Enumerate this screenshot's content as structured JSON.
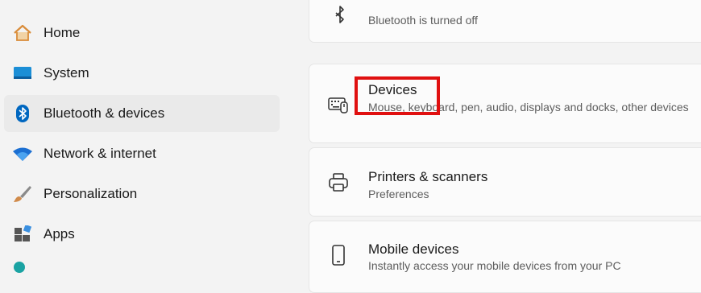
{
  "sidebar": {
    "items": [
      {
        "label": "Home",
        "icon": "home-icon",
        "selected": false
      },
      {
        "label": "System",
        "icon": "system-icon",
        "selected": false
      },
      {
        "label": "Bluetooth & devices",
        "icon": "bluetooth-icon",
        "selected": true
      },
      {
        "label": "Network & internet",
        "icon": "wifi-icon",
        "selected": false
      },
      {
        "label": "Personalization",
        "icon": "brush-icon",
        "selected": false
      },
      {
        "label": "Apps",
        "icon": "apps-icon",
        "selected": false
      }
    ]
  },
  "main": {
    "bluetooth_status": "Bluetooth is turned off",
    "cards": [
      {
        "title": "Devices",
        "subtitle": "Mouse, keyboard, pen, audio, displays and docks, other devices",
        "icon": "keyboard-mouse-icon"
      },
      {
        "title": "Printers & scanners",
        "subtitle": "Preferences",
        "icon": "printer-icon"
      },
      {
        "title": "Mobile devices",
        "subtitle": "Instantly access your mobile devices from your PC",
        "icon": "phone-icon"
      }
    ]
  },
  "colors": {
    "accent": "#0067c0",
    "highlight": "#e01010",
    "background": "#f3f3f3",
    "card": "#fbfbfb"
  }
}
